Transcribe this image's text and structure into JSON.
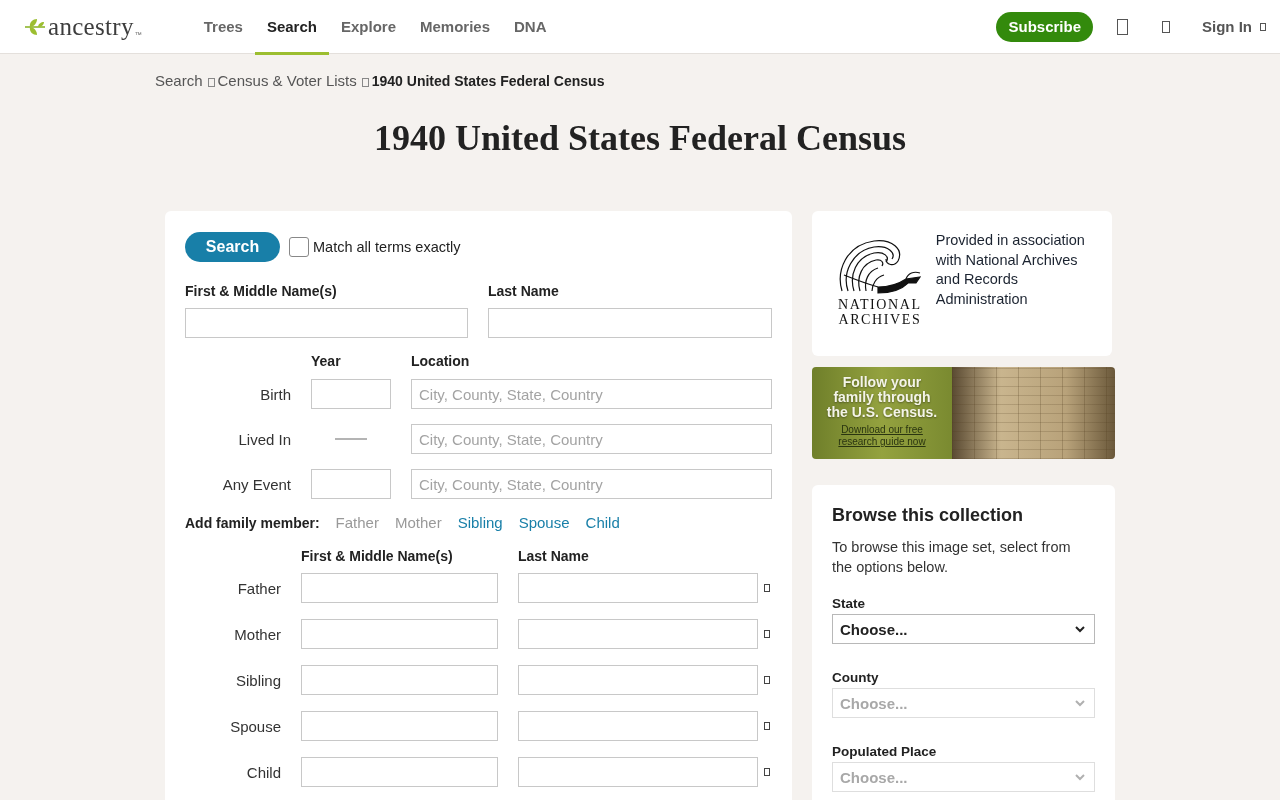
{
  "header": {
    "logo": {
      "text": "ancestry",
      "mark": "™"
    },
    "nav": [
      {
        "label": "Trees",
        "selected": false
      },
      {
        "label": "Search",
        "selected": true
      },
      {
        "label": "Explore",
        "selected": false
      },
      {
        "label": "Memories",
        "selected": false
      },
      {
        "label": "DNA",
        "selected": false
      }
    ],
    "subscribe": "Subscribe",
    "sign_in": "Sign In"
  },
  "breadcrumb": [
    {
      "label": "Search",
      "current": false
    },
    {
      "label": "Census & Voter Lists",
      "current": false
    },
    {
      "label": "1940 United States Federal Census",
      "current": true
    }
  ],
  "title": "1940 United States Federal Census",
  "search_form": {
    "search_button": "Search",
    "match_exact": {
      "label": "Match all terms exactly",
      "checked": false
    },
    "name_fields": [
      {
        "label": "First & Middle Name(s)"
      },
      {
        "label": "Last Name"
      }
    ],
    "event_columns": [
      "Year",
      "Location"
    ],
    "events": [
      {
        "label": "Birth",
        "kind": "year-field",
        "location_placeholder": "City, County, State, Country"
      },
      {
        "label": "Lived In",
        "kind": "dash",
        "location_placeholder": "City, County, State, Country"
      },
      {
        "label": "Any Event",
        "kind": "year-field",
        "location_placeholder": "City, County, State, Country"
      }
    ],
    "family_prompt": "Add family member:",
    "family_links": [
      {
        "label": "Father",
        "disabled": true
      },
      {
        "label": "Mother",
        "disabled": true
      },
      {
        "label": "Sibling",
        "disabled": false
      },
      {
        "label": "Spouse",
        "disabled": false
      },
      {
        "label": "Child",
        "disabled": false
      }
    ],
    "family_columns": [
      "First & Middle Name(s)",
      "Last Name"
    ],
    "family_rows": [
      {
        "label": "Father"
      },
      {
        "label": "Mother"
      },
      {
        "label": "Sibling"
      },
      {
        "label": "Spouse"
      },
      {
        "label": "Child"
      }
    ]
  },
  "archives_panel": {
    "logo_lines": [
      "NATIONAL",
      "ARCHIVES"
    ],
    "text": "Provided in association with National Archives and Records Administration"
  },
  "banner": {
    "headline": "Follow your family through the U.S. Census.",
    "link": "Download our free research guide now"
  },
  "browse": {
    "title": "Browse this collection",
    "description": "To browse this image set, select from the options below.",
    "selects": [
      {
        "label": "State",
        "value": "Choose...",
        "disabled": false
      },
      {
        "label": "County",
        "value": "Choose...",
        "disabled": true
      },
      {
        "label": "Populated Place",
        "value": "Choose...",
        "disabled": true
      }
    ]
  }
}
